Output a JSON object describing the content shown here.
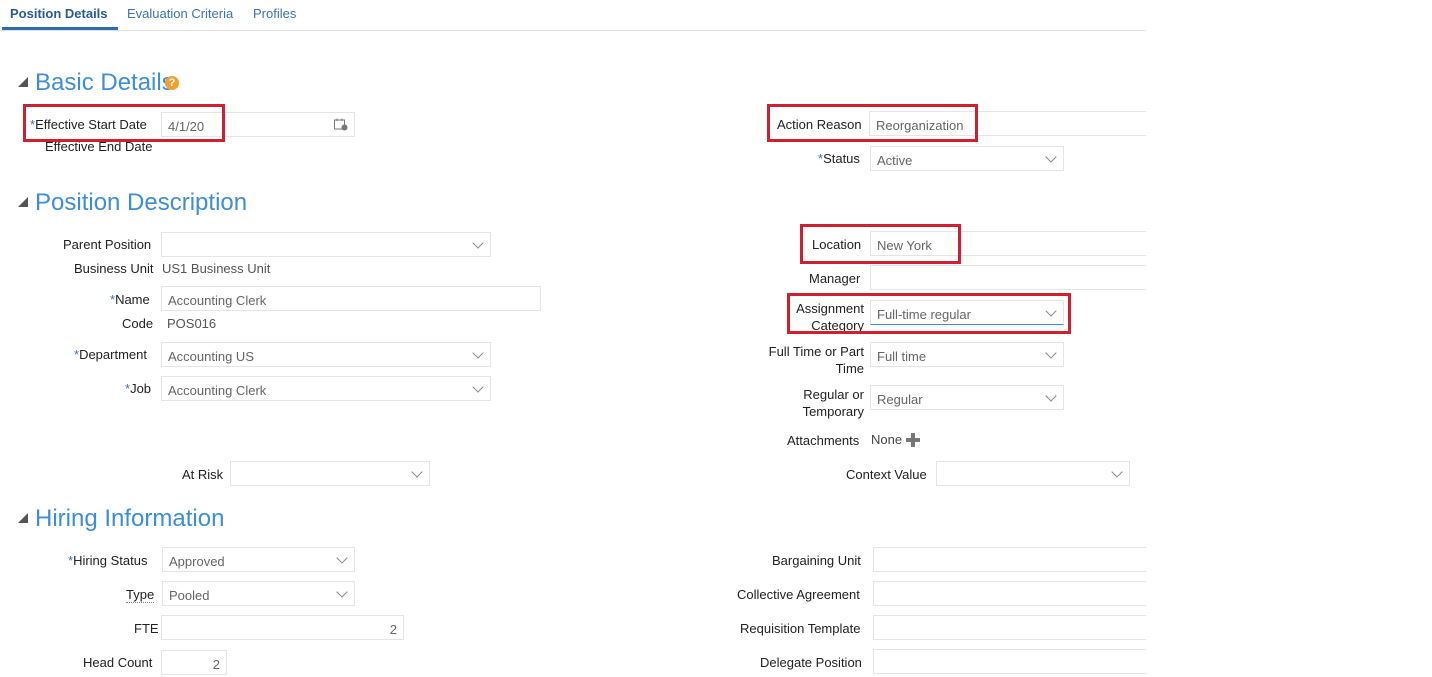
{
  "tabs": [
    "Position Details",
    "Evaluation Criteria",
    "Profiles"
  ],
  "sections": {
    "basic": "Basic Details",
    "position": "Position Description",
    "hiring": "Hiring Information"
  },
  "help_glyph": "?",
  "basic": {
    "effective_start_label": "Effective Start Date",
    "effective_start_value": "4/1/20",
    "effective_end_label": "Effective End Date",
    "action_reason_label": "Action Reason",
    "action_reason_value": "Reorganization",
    "status_label": "Status",
    "status_value": "Active"
  },
  "position": {
    "parent_position_label": "Parent Position",
    "parent_position_value": "",
    "business_unit_label": "Business Unit",
    "business_unit_value": "US1 Business Unit",
    "name_label": "Name",
    "name_value": "Accounting Clerk",
    "code_label": "Code",
    "code_value": "POS016",
    "department_label": "Department",
    "department_value": "Accounting US",
    "job_label": "Job",
    "job_value": "Accounting Clerk",
    "at_risk_label": "At Risk",
    "location_label": "Location",
    "location_value": "New York",
    "manager_label": "Manager",
    "assignment_category_label": "Assignment Category",
    "assignment_category_value": "Full-time regular",
    "full_part_label": "Full Time or Part Time",
    "full_part_value": "Full time",
    "regular_temp_label": "Regular or Temporary",
    "regular_temp_value": "Regular",
    "attachments_label": "Attachments",
    "attachments_value": "None",
    "context_value_label": "Context Value"
  },
  "hiring": {
    "hiring_status_label": "Hiring Status",
    "hiring_status_value": "Approved",
    "type_label": "Type",
    "type_value": "Pooled",
    "fte_label": "FTE",
    "fte_value": "2",
    "head_count_label": "Head Count",
    "head_count_value": "2",
    "bargaining_unit_label": "Bargaining Unit",
    "collective_agreement_label": "Collective Agreement",
    "requisition_template_label": "Requisition Template",
    "delegate_position_label": "Delegate Position"
  },
  "required_marker": "*",
  "colors": {
    "accent": "#3d8ed6",
    "highlight_box": "#cf2030",
    "help_icon": "#f0a030"
  }
}
